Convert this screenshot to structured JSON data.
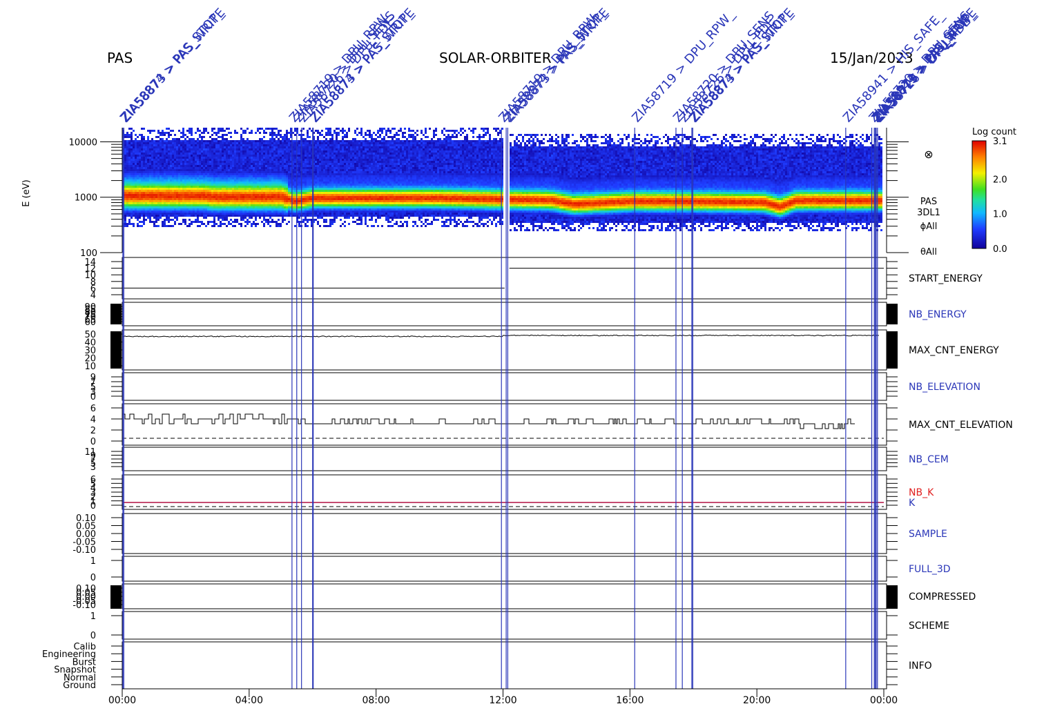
{
  "header": {
    "instrument": "PAS",
    "mission": "SOLAR-ORBITER",
    "date": "15/Jan/2023"
  },
  "colors": {
    "annotation": "#2a36b8",
    "panel_label_black": "#000000",
    "panel_label_blue": "#2a36b8",
    "panel_label_red": "#e02020",
    "k_line": "#b01040"
  },
  "chart_data": {
    "type": "heatmap",
    "x_ticks": [
      "00:00",
      "04:00",
      "08:00",
      "12:00",
      "16:00",
      "20:00",
      "00:00"
    ],
    "x_range_hours": [
      0,
      24
    ],
    "spectrogram": {
      "ylabel": "E (eV)",
      "y_scale": "log",
      "y_ticks": [
        "10000",
        "1000",
        "100"
      ],
      "y_range": [
        100,
        18000
      ],
      "colorbar": {
        "title": "Log count",
        "ticks": [
          "3.1",
          "2.0",
          "1.0",
          "0.0"
        ],
        "range": [
          0.0,
          3.1
        ]
      },
      "side_labels": [
        "PAS",
        "3DL1",
        "ϕAll",
        "θAll"
      ],
      "peak_energy_profile": [
        {
          "t": 0,
          "e": 1100
        },
        {
          "t": 2.6,
          "e": 1100
        },
        {
          "t": 2.8,
          "e": 1050
        },
        {
          "t": 5.0,
          "e": 1050
        },
        {
          "t": 5.4,
          "e": 880
        },
        {
          "t": 6.0,
          "e": 1000
        },
        {
          "t": 10,
          "e": 1000
        },
        {
          "t": 12,
          "e": 950
        },
        {
          "t": 13.5,
          "e": 920
        },
        {
          "t": 14.2,
          "e": 780
        },
        {
          "t": 15.0,
          "e": 820
        },
        {
          "t": 16,
          "e": 880
        },
        {
          "t": 18,
          "e": 870
        },
        {
          "t": 20.2,
          "e": 840
        },
        {
          "t": 20.7,
          "e": 700
        },
        {
          "t": 21.2,
          "e": 900
        },
        {
          "t": 24,
          "e": 900
        }
      ]
    },
    "panels": [
      {
        "name": "START_ENERGY",
        "color": "black",
        "ticks": [
          "14",
          "12",
          "10",
          "8",
          "6",
          "4"
        ],
        "series": [
          {
            "t0": 0,
            "t1": 12.05,
            "y": 6
          },
          {
            "t0": 12.2,
            "t1": 24,
            "y": 12
          }
        ]
      },
      {
        "name": "NB_ENERGY",
        "color": "blue",
        "ticks": [
          "90",
          "85",
          "80",
          "75",
          "70",
          "65",
          "60"
        ]
      },
      {
        "name": "MAX_CNT_ENERGY",
        "color": "black",
        "ticks": [
          "50",
          "40",
          "30",
          "20",
          "10"
        ],
        "series_mean": 47
      },
      {
        "name": "NB_ELEVATION",
        "color": "blue",
        "ticks": [
          "9",
          "7",
          "5",
          "3",
          "0"
        ]
      },
      {
        "name": "MAX_CNT_ELEVATION",
        "color": "black",
        "ticks": [
          "6",
          "4",
          "2",
          "0"
        ],
        "series_mean": 3.5
      },
      {
        "name": "NB_CEM",
        "color": "blue",
        "ticks": [
          "11",
          "9",
          "7",
          "5",
          "3"
        ]
      },
      {
        "name": "NB_K",
        "color": "red",
        "ticks": [
          "6",
          "5",
          "4",
          "3",
          "2",
          "1",
          "0"
        ],
        "extra_label": "K"
      },
      {
        "name": "SAMPLE",
        "color": "blue",
        "ticks": [
          "0.10",
          "0.05",
          "0.00",
          "-0.05",
          "-0.10"
        ]
      },
      {
        "name": "FULL_3D",
        "color": "blue",
        "ticks": [
          "1",
          "0"
        ]
      },
      {
        "name": "COMPRESSED",
        "color": "black",
        "ticks": [
          "0.10",
          "0.05",
          "0.00",
          "-0.05",
          "-0.10"
        ]
      },
      {
        "name": "SCHEME",
        "color": "black",
        "ticks": [
          "1",
          "0"
        ]
      },
      {
        "name": "INFO",
        "color": "black",
        "ticks": [
          "Calib",
          "Engineering",
          "Burst",
          "Snapshot",
          "Normal",
          "Ground"
        ]
      }
    ],
    "annotations": [
      {
        "t": 0.02,
        "text": "ZIA58874 > PAS_STOP_"
      },
      {
        "t": 0.05,
        "text": "ZIA58873 > PAS_WRITE"
      },
      {
        "t": 5.35,
        "text": "ZIA58719 > DPU_RPW_"
      },
      {
        "t": 5.5,
        "text": "ZIA58720 > DPU_SENS"
      },
      {
        "t": 5.65,
        "text": "ZIA58726 > DPU_PDE"
      },
      {
        "t": 6.0,
        "text": "ZIA58874 > PAS_STOP_"
      },
      {
        "t": 6.02,
        "text": "ZIA58873 > PAS_WRITE"
      },
      {
        "t": 11.95,
        "text": "ZIA58719 > DPU_RPW_"
      },
      {
        "t": 12.1,
        "text": "ZIA58874 > PAS_STOP_"
      },
      {
        "t": 12.15,
        "text": "ZIA58873 > PAS_WRITE"
      },
      {
        "t": 16.15,
        "text": "ZIA58719 > DPU_RPW_"
      },
      {
        "t": 17.45,
        "text": "ZIA58720 > DPU_SENS"
      },
      {
        "t": 17.65,
        "text": "ZIA58726 > DPU_PDE"
      },
      {
        "t": 17.95,
        "text": "ZIA58874 > PAS_STOP_"
      },
      {
        "t": 17.98,
        "text": "ZIA58873 > PAS_WRITE"
      },
      {
        "t": 22.8,
        "text": "ZIA58941 > HIS_SAFE_"
      },
      {
        "t": 23.62,
        "text": "ZIA58720 > DPU_SENS"
      },
      {
        "t": 23.7,
        "text": "ZIA58874 > PAS_STOP_"
      },
      {
        "t": 23.73,
        "text": "ZIA58873 > PAS_WRITE"
      },
      {
        "t": 23.76,
        "text": "ZIA58719 > DPU_RPW_"
      },
      {
        "t": 23.8,
        "text": "ZIA58726 > DPU_PDE"
      }
    ]
  }
}
